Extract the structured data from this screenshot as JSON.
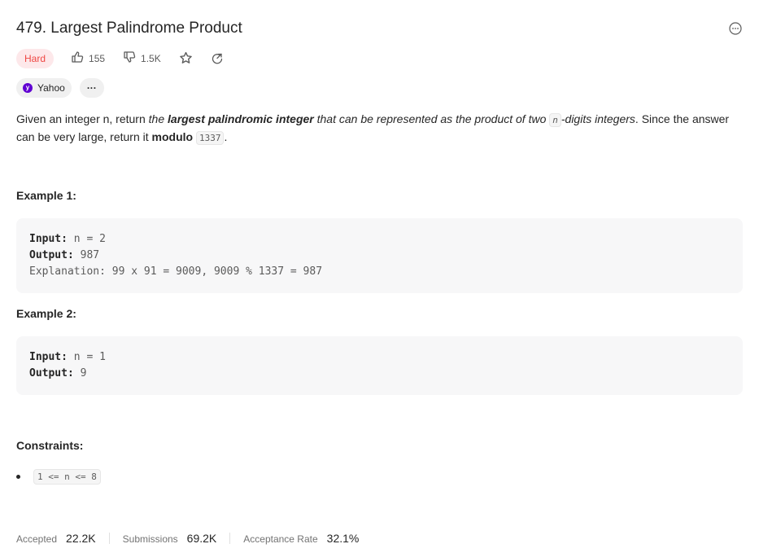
{
  "problem": {
    "title": "479. Largest Palindrome Product",
    "difficulty": "Hard",
    "likes": "155",
    "dislikes": "1.5K",
    "difficulty_color": "#ef4743"
  },
  "tags": {
    "company": "Yahoo",
    "more": "···"
  },
  "description": {
    "p1": "Given an integer n, return ",
    "p2": "the ",
    "p3": "largest palindromic integer",
    "p4": " that can be represented as the product of two ",
    "code_n": "n",
    "p5": "-digits integers",
    "p6": ". Since the answer can be very large, return it ",
    "p7": "modulo",
    "code_mod": "1337",
    "p8": "."
  },
  "examples": [
    {
      "title": "Example 1:",
      "input_label": "Input:",
      "input_value": " n = 2",
      "output_label": "Output:",
      "output_value": " 987",
      "explanation": "Explanation: 99 x 91 = 9009, 9009 % 1337 = 987"
    },
    {
      "title": "Example 2:",
      "input_label": "Input:",
      "input_value": " n = 1",
      "output_label": "Output:",
      "output_value": " 9"
    }
  ],
  "constraints": {
    "title": "Constraints:",
    "items": [
      "1 <= n <= 8"
    ]
  },
  "stats": {
    "accepted_label": "Accepted",
    "accepted_value": "22.2K",
    "submissions_label": "Submissions",
    "submissions_value": "69.2K",
    "rate_label": "Acceptance Rate",
    "rate_value": "32.1%"
  },
  "icons": [
    "more-icon",
    "thumbs-up-icon",
    "thumbs-down-icon",
    "star-icon",
    "share-icon",
    "yahoo-logo-icon"
  ]
}
